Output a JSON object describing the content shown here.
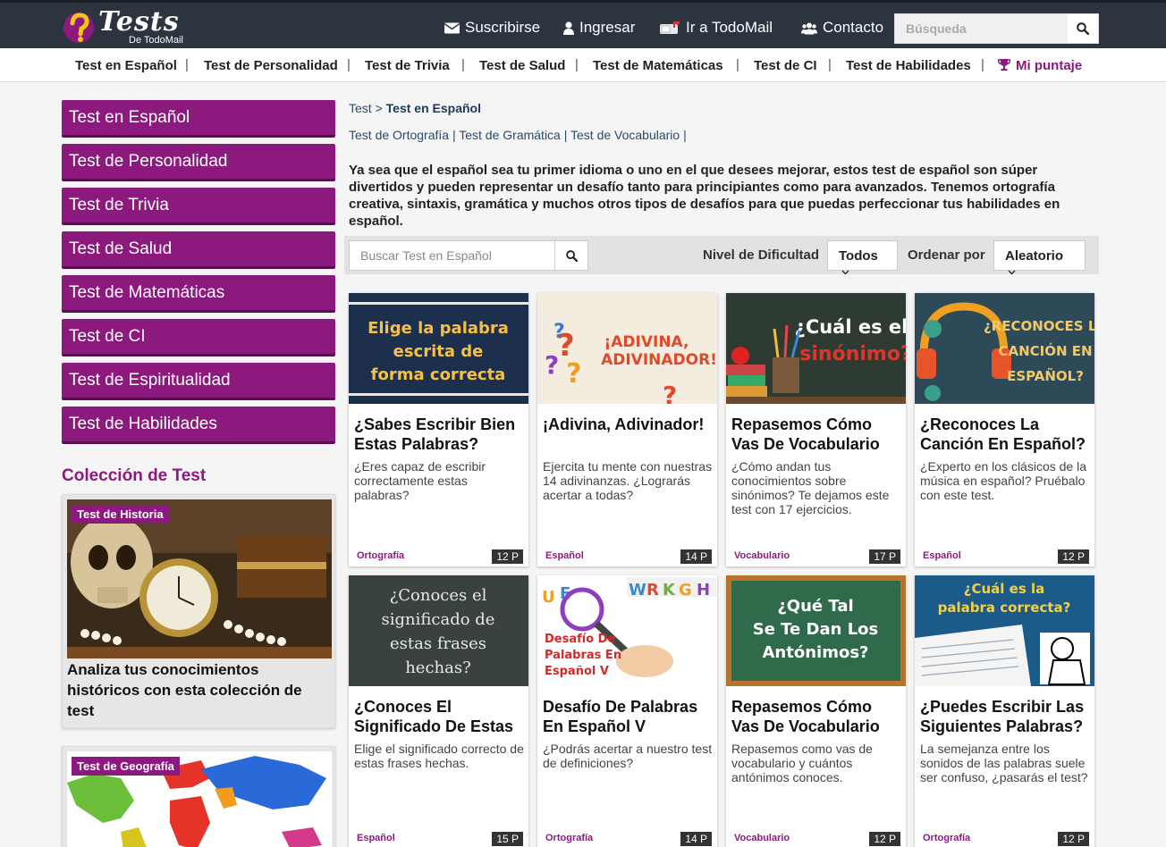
{
  "header": {
    "brand": "Tests",
    "brand_sub": "De TodoMail",
    "nav": [
      {
        "label": "Suscribirse",
        "icon": "envelope-icon"
      },
      {
        "label": "Ingresar",
        "icon": "user-icon"
      },
      {
        "label": "Ir a TodoMail",
        "icon": "mailbox-icon"
      },
      {
        "label": "Contacto",
        "icon": "users-icon"
      }
    ],
    "search_placeholder": "Búsqueda"
  },
  "categories": [
    "Test en Español",
    "Test de Personalidad",
    "Test de Trivia",
    "Test de Salud",
    "Test de Matemáticas",
    "Test de CI",
    "Test de Habilidades"
  ],
  "score_label": "Mi puntaje",
  "sidebar": {
    "items": [
      "Test en Español",
      "Test de Personalidad",
      "Test de Trivia",
      "Test de Salud",
      "Test de Matemáticas",
      "Test de CI",
      "Test de Espiritualidad",
      "Test de Habilidades"
    ],
    "collection_title": "Colección de Test",
    "collections": [
      {
        "tag": "Test de Historia",
        "text": "Analiza tus conocimientos históricos con esta colección de test"
      },
      {
        "tag": "Test de Geografía",
        "text": ""
      }
    ]
  },
  "breadcrumb": {
    "root": "Test",
    "sep": ">",
    "current": "Test en Español"
  },
  "sublinks": [
    "Test de Ortografía",
    "Test de Gramática",
    "Test de Vocabulario"
  ],
  "intro": "Ya sea que el español sea tu primer idioma o uno en el que desees mejorar, estos test de español son súper divertidos y pueden representar un desafío tanto para principiantes como para avanzados. Tenemos ortografía creativa, sintaxis, gramática y muchos otros tipos de desafíos para que puedas perfeccionar tus habilidades en español.",
  "filters": {
    "search_placeholder": "Buscar Test en Español",
    "difficulty_label": "Nivel de Dificultad",
    "difficulty_value": "Todos",
    "order_label": "Ordenar por",
    "order_value": "Aleatorio"
  },
  "cards": [
    {
      "thumb_text": "Elige la palabra escrita de forma correcta",
      "title": "¿Sabes Escribir Bien Estas Palabras?",
      "desc": "¿Eres capaz de escribir correctamente estas palabras?",
      "tag": "Ortografía",
      "count": "12 P"
    },
    {
      "thumb_text": "¡ADIVINA, ADIVINADOR!",
      "title": "¡Adivina, Adivinador!",
      "desc": "Ejercita tu mente con nuestras 14 adivinanzas. ¿Lograrás acertar a todas?",
      "tag": "Español",
      "count": "14 P"
    },
    {
      "thumb_text": "¿Cuál es el sinónimo?",
      "title": "Repasemos Cómo Vas De Vocabulario",
      "desc": "¿Cómo andan tus conocimientos sobre sinónimos? Te dejamos este test con 17 ejercicios.",
      "tag": "Vocabulario",
      "count": "17 P"
    },
    {
      "thumb_text": "¿RECONOCES LA CANCIÓN EN ESPAÑOL?",
      "title": "¿Reconoces La Canción En Español?",
      "desc": "¿Experto en los clásicos de la música en español? Pruébalo con este test.",
      "tag": "Español",
      "count": "12 P"
    },
    {
      "thumb_text": "¿Conoces el significado de estas frases hechas?",
      "title": "¿Conoces El Significado De Estas",
      "desc": "Elige el significado correcto de estas frases hechas.",
      "tag": "Español",
      "count": "15 P"
    },
    {
      "thumb_text": "Desafío De Palabras En Español V",
      "title": "Desafío De Palabras En Español V",
      "desc": "¿Podrás acertar a nuestro test de definiciones?",
      "tag": "Ortografía",
      "count": "14 P"
    },
    {
      "thumb_text": "¿Qué Tal Se Te Dan Los Antónimos?",
      "title": "Repasemos Cómo Vas De Vocabulario",
      "desc": "Repasemos como vas de vocabulario y cuántos antónimos conoces.",
      "tag": "Vocabulario",
      "count": "12 P"
    },
    {
      "thumb_text": "¿Cuál es la palabra correcta?",
      "title": "¿Puedes Escribir Las Siguientes Palabras?",
      "desc": "La semejanza entre los sonidos de las palabras suele ser confuso, ¿pasarás el test?",
      "tag": "Ortografía",
      "count": "12 P"
    }
  ],
  "colors": {
    "brand": "#8c1a7e",
    "topbar": "#2c3440",
    "link": "#2a4a6b"
  }
}
